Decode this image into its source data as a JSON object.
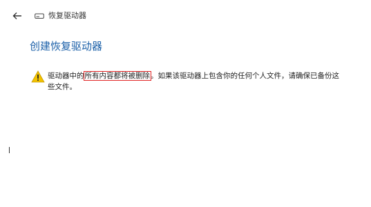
{
  "header": {
    "window_title": "恢复驱动器",
    "back_icon": "back-arrow-icon",
    "drive_icon": "drive-icon"
  },
  "main": {
    "title": "创建恢复驱动器",
    "warning": {
      "icon": "warning-icon",
      "text_before": "驱动器中的",
      "highlight": "所有内容都将被删除",
      "text_after": "。如果该驱动器上包含你的任何个人文件，请确保已备份这些文件。"
    }
  },
  "colors": {
    "title": "#1a5fa8",
    "warning_icon": "#f2c200",
    "highlight_box": "#e02020"
  }
}
